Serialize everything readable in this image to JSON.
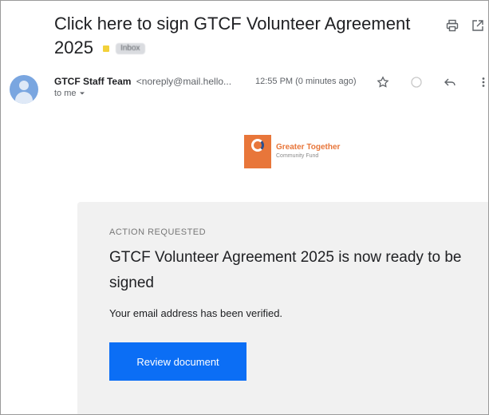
{
  "email": {
    "subject": "Click here to sign GTCF Volunteer Agreement 2025",
    "label": "Inbox",
    "sender_name": "GTCF Staff Team",
    "sender_email": "<noreply@mail.hello...",
    "time": "12:55 PM (0 minutes ago)",
    "to": "to me"
  },
  "icons": {
    "print": "print-icon",
    "open_new": "open-in-new-icon",
    "star": "star-icon",
    "emoji": "emoji-icon",
    "reply": "reply-icon",
    "more": "more-vert-icon",
    "caret": "caret-down-icon"
  },
  "logo": {
    "line1": "Greater Together",
    "line2": "Community Fund"
  },
  "card": {
    "eyebrow": "ACTION REQUESTED",
    "heading": "GTCF Volunteer Agreement 2025 is now ready to be signed",
    "body": "Your email address has been verified.",
    "button": "Review document"
  },
  "colors": {
    "button": "#0b6ef5",
    "brand": "#e8763a",
    "card_bg": "#f1f1f1"
  }
}
